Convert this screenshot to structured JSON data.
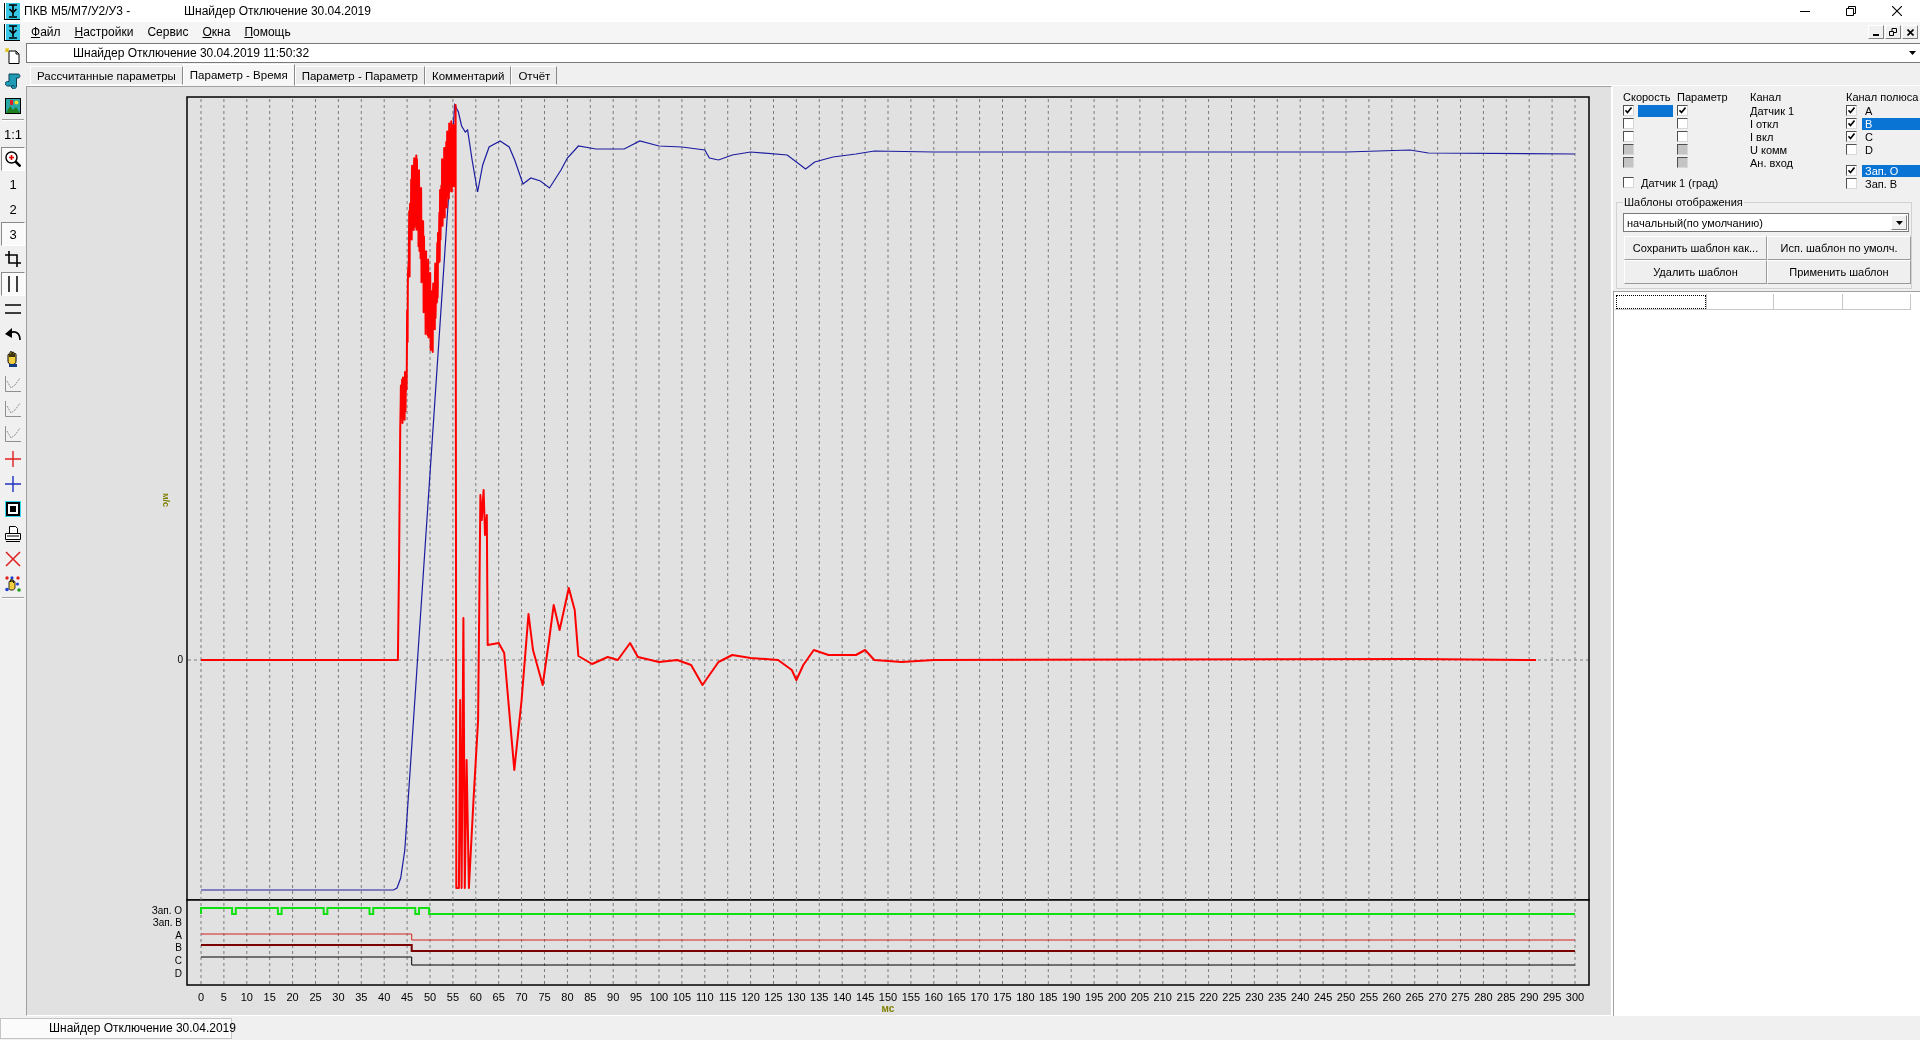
{
  "title_bar": {
    "app_title": "ПКВ М5/М7/У2/У3 -",
    "document_title": "Шнайдер Отключение 30.04.2019"
  },
  "menu": [
    {
      "label": "Файл",
      "mnemonic": true
    },
    {
      "label": "Настройки",
      "mnemonic": true
    },
    {
      "label": "Сервис",
      "mnemonic": false
    },
    {
      "label": "Окна",
      "mnemonic": true
    },
    {
      "label": "Помощь",
      "mnemonic": true
    }
  ],
  "toolbar": [
    {
      "kind": "icon",
      "pressed": false,
      "disabled": false
    },
    {
      "kind": "icon",
      "pressed": false,
      "disabled": false
    },
    {
      "kind": "icon",
      "pressed": false,
      "disabled": false
    },
    {
      "kind": "separator"
    },
    {
      "kind": "text",
      "label": "1:1",
      "pressed": false,
      "disabled": false
    },
    {
      "kind": "icon",
      "pressed": true,
      "disabled": false
    },
    {
      "kind": "text",
      "label": "1",
      "pressed": false,
      "disabled": false
    },
    {
      "kind": "text",
      "label": "2",
      "pressed": false,
      "disabled": false
    },
    {
      "kind": "text",
      "label": "3",
      "pressed": true,
      "disabled": false
    },
    {
      "kind": "icon",
      "pressed": false,
      "disabled": false
    },
    {
      "kind": "icon",
      "pressed": true,
      "disabled": false
    },
    {
      "kind": "icon",
      "pressed": false,
      "disabled": false
    },
    {
      "kind": "icon",
      "pressed": false,
      "disabled": false
    },
    {
      "kind": "icon",
      "pressed": false,
      "disabled": false
    },
    {
      "kind": "icon",
      "pressed": false,
      "disabled": true
    },
    {
      "kind": "icon",
      "pressed": false,
      "disabled": true
    },
    {
      "kind": "icon",
      "pressed": false,
      "disabled": true
    },
    {
      "kind": "icon",
      "pressed": false,
      "disabled": false
    },
    {
      "kind": "icon",
      "pressed": false,
      "disabled": false
    },
    {
      "kind": "icon",
      "pressed": false,
      "disabled": false
    },
    {
      "kind": "icon",
      "pressed": false,
      "disabled": false
    },
    {
      "kind": "icon",
      "pressed": false,
      "disabled": false
    },
    {
      "kind": "icon",
      "pressed": false,
      "disabled": false
    },
    {
      "kind": "separator"
    }
  ],
  "record_selector": {
    "value": "Шнайдер Отключение 30.04.2019 11:50:32"
  },
  "tabs": [
    {
      "label": "Рассчитанные параметры",
      "selected": false
    },
    {
      "label": "Параметр - Время",
      "selected": true
    },
    {
      "label": "Параметр - Параметр",
      "selected": false
    },
    {
      "label": "Комментарий",
      "selected": false
    },
    {
      "label": "Отчёт",
      "selected": false
    }
  ],
  "plot": {
    "y_axis_label": "м/с",
    "y_ticks": [
      "0"
    ],
    "logic_channels": [
      "Зап. О",
      "Зап. В",
      "A",
      "B",
      "C",
      "D"
    ],
    "x_ticks": [
      "0",
      "5",
      "10",
      "15",
      "20",
      "25",
      "30",
      "35",
      "40",
      "45",
      "50",
      "55",
      "60",
      "65",
      "70",
      "75",
      "80",
      "85",
      "90",
      "95",
      "100",
      "105",
      "110",
      "115",
      "120",
      "125",
      "130",
      "135",
      "140",
      "145",
      "150",
      "155",
      "160",
      "165",
      "170",
      "175",
      "180",
      "185",
      "190",
      "195",
      "200",
      "205",
      "210",
      "215",
      "220",
      "225",
      "230",
      "235",
      "240",
      "245",
      "250",
      "255",
      "260",
      "265",
      "270",
      "275",
      "280",
      "285",
      "290",
      "295",
      "300"
    ],
    "x_axis_label": "мс"
  },
  "channel_panel": {
    "headers": {
      "speed": "Скорость",
      "parameter": "Параметр",
      "channel": "Канал",
      "pole_channel": "Канал полюса"
    },
    "channels": [
      {
        "name": "Датчик 1",
        "speed_checked": true,
        "speed_disabled": false,
        "parameter_checked": true,
        "parameter_disabled": false,
        "selected": true
      },
      {
        "name": "I откл",
        "speed_checked": false,
        "speed_disabled": false,
        "parameter_checked": false,
        "parameter_disabled": false,
        "selected": false
      },
      {
        "name": "I вкл",
        "speed_checked": false,
        "speed_disabled": false,
        "parameter_checked": false,
        "parameter_disabled": false,
        "selected": false
      },
      {
        "name": "U комм",
        "speed_checked": false,
        "speed_disabled": true,
        "parameter_checked": false,
        "parameter_disabled": true,
        "selected": false
      },
      {
        "name": "Ан. вход",
        "speed_checked": false,
        "speed_disabled": true,
        "parameter_checked": false,
        "parameter_disabled": true,
        "selected": false
      }
    ],
    "degrees_option": {
      "label": "Датчик 1 (град)",
      "checked": false
    },
    "pole_channels": [
      {
        "label": "A",
        "checked": true,
        "selected": false
      },
      {
        "label": "B",
        "checked": true,
        "selected": true
      },
      {
        "label": "C",
        "checked": true,
        "selected": false
      },
      {
        "label": "D",
        "checked": false,
        "selected": false
      }
    ],
    "record_channels": [
      {
        "label": "Зап. О",
        "checked": true,
        "selected": true
      },
      {
        "label": "Зап. В",
        "checked": false,
        "selected": false
      }
    ]
  },
  "templates": {
    "title": "Шаблоны отображения",
    "selected_template": "начальный(по умолчанию)",
    "buttons": [
      "Сохранить шаблон как...",
      "Исп. шаблон по умолч.",
      "Удалить шаблон",
      "Применить шаблон"
    ]
  },
  "status_bar": {
    "text": "Шнайдер Отключение 30.04.2019"
  }
}
